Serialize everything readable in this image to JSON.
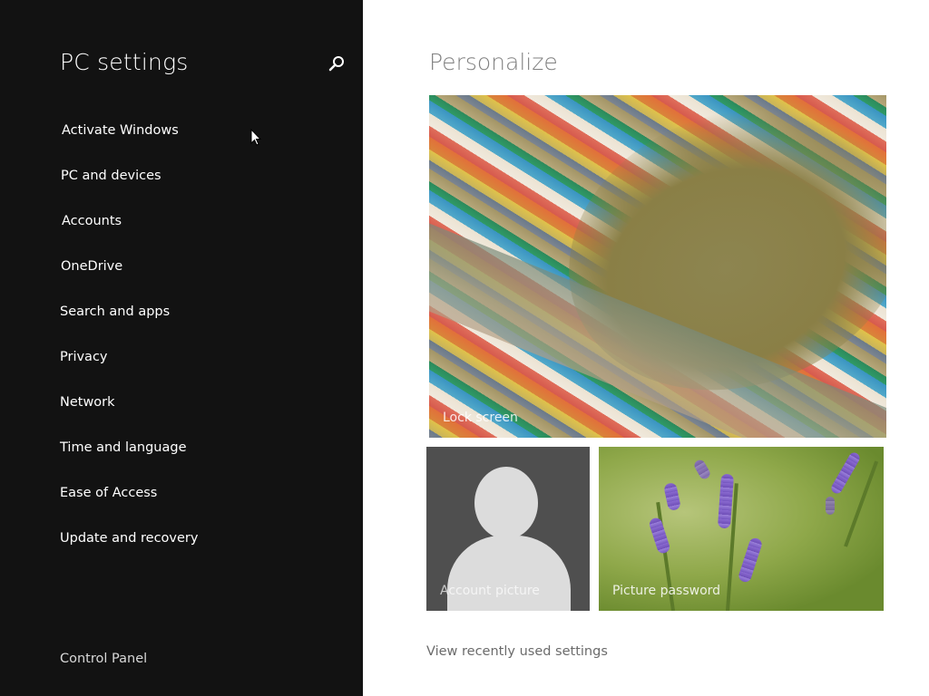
{
  "window": {
    "title": "PC settings"
  },
  "sidebar": {
    "title": "PC settings",
    "search_icon": "search-icon",
    "items": [
      {
        "label": "Activate Windows"
      },
      {
        "label": "PC and devices"
      },
      {
        "label": "Accounts"
      },
      {
        "label": "OneDrive"
      },
      {
        "label": "Search and apps"
      },
      {
        "label": "Privacy"
      },
      {
        "label": "Network"
      },
      {
        "label": "Time and language"
      },
      {
        "label": "Ease of Access"
      },
      {
        "label": "Update and recovery"
      }
    ],
    "footer_link": "Control Panel"
  },
  "main": {
    "title": "Personalize",
    "tiles": {
      "lock_screen": {
        "label": "Lock screen"
      },
      "account_picture": {
        "label": "Account picture"
      },
      "picture_password": {
        "label": "Picture password"
      }
    },
    "recent_link": "View recently used settings"
  },
  "colors": {
    "sidebar_bg": "#121212",
    "main_bg": "#ffffff",
    "title_gray": "#808080",
    "link_gray": "#6b6b6b"
  }
}
